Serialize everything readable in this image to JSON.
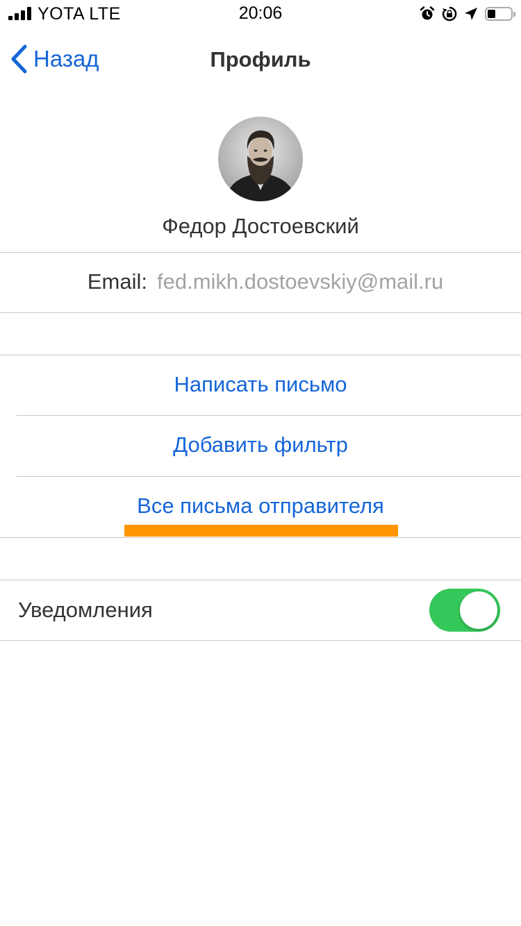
{
  "status_bar": {
    "carrier": "YOTA LTE",
    "time": "20:06",
    "icons": [
      "signal-icon",
      "alarm-icon",
      "rotation-lock-icon",
      "location-arrow-icon",
      "battery-icon"
    ]
  },
  "nav": {
    "back_label": "Назад",
    "title": "Профиль"
  },
  "profile": {
    "name": "Федор Достоевский",
    "email_label": "Email:",
    "email_value": "fed.mikh.dostoevskiy@mail.ru"
  },
  "actions": [
    {
      "label": "Написать письмо"
    },
    {
      "label": "Добавить фильтр"
    },
    {
      "label": "Все письма отправителя"
    }
  ],
  "settings": {
    "notifications_label": "Уведомления",
    "notifications_on": true
  },
  "colors": {
    "link": "#1565d8",
    "toggle_on": "#34c759",
    "highlight": "#ff9500",
    "separator": "#c8c7cc"
  }
}
